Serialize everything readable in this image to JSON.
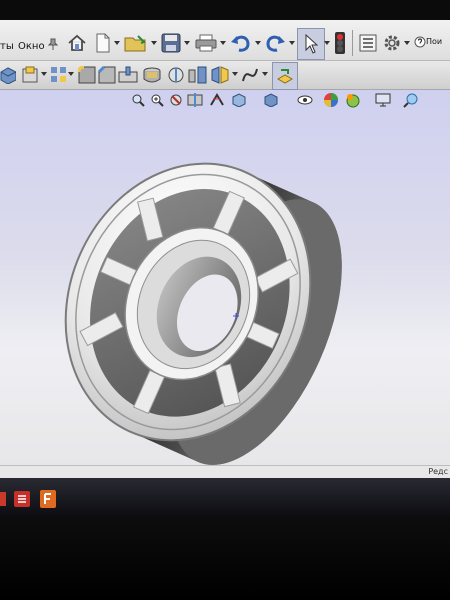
{
  "menubar": {
    "items": [
      {
        "label": "ты"
      },
      {
        "label": "Окно"
      }
    ],
    "help_text": "Пои"
  },
  "statusbar": {
    "right_text": "Редс"
  },
  "toolbar_icons": [
    "home-icon",
    "new-document-icon",
    "open-folder-icon",
    "save-icon",
    "print-icon",
    "undo-icon",
    "redo-icon",
    "select-cursor-icon",
    "traffic-light-icon",
    "options-list-icon",
    "settings-gear-icon",
    "help-icon"
  ],
  "view_icons": [
    "zoom-to-fit-icon",
    "zoom-area-icon",
    "previous-view-icon",
    "section-view-icon",
    "dynamic-annotation-icon",
    "view-orientation-icon",
    "display-style-icon",
    "hide-show-icon",
    "edit-appearance-icon",
    "apply-scene-icon",
    "view-settings-icon",
    "pin-icon"
  ],
  "taskbar_apps": [
    "solidworks-taskbar-icon",
    "app-taskbar-icon"
  ]
}
